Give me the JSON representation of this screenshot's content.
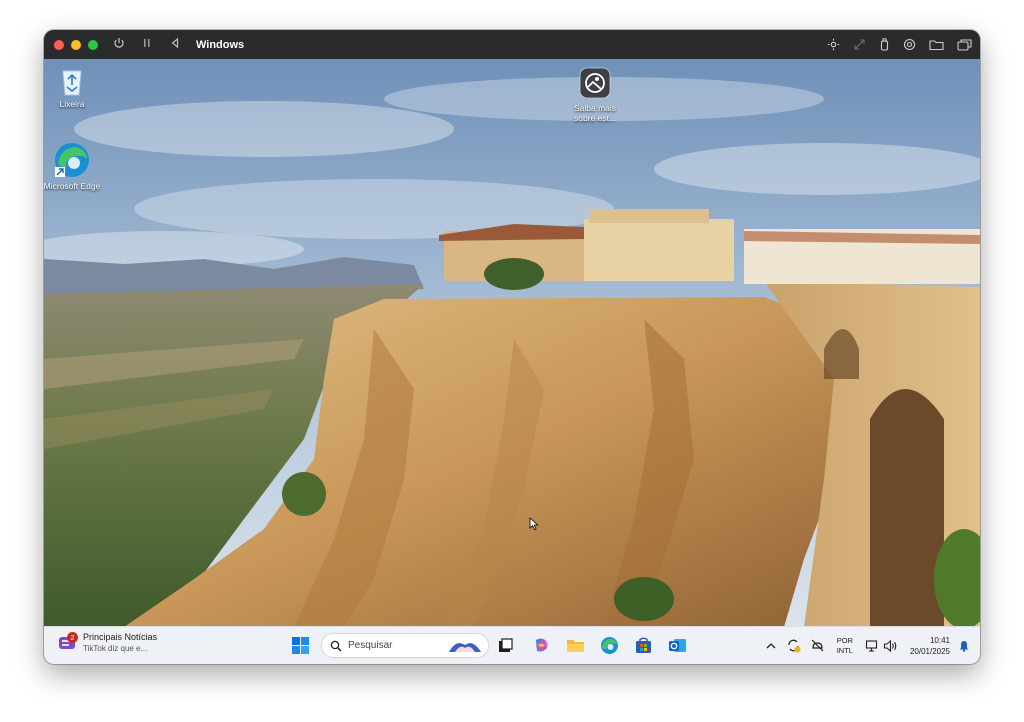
{
  "window": {
    "title": "Windows"
  },
  "desktop": {
    "icons": [
      {
        "label": "Lixeira",
        "icon": "recycle-bin-icon"
      },
      {
        "label": "Microsoft Edge",
        "icon": "edge-icon"
      },
      {
        "label": "Saiba mais sobre est...",
        "icon": "learn-about-picture-icon"
      }
    ]
  },
  "taskbar": {
    "news": {
      "title": "Principais Notícias",
      "subtitle": "TikTok diz que e...",
      "badge": "2"
    },
    "search": {
      "placeholder": "Pesquisar"
    },
    "tray": {
      "lang_line1": "POR",
      "lang_line2": "INTL",
      "time": "10:41",
      "date": "20/01/2025"
    }
  },
  "colors": {
    "accent": "#0078d4",
    "titlebar": "#2b2b2d",
    "taskbar": "#eef1f6"
  }
}
